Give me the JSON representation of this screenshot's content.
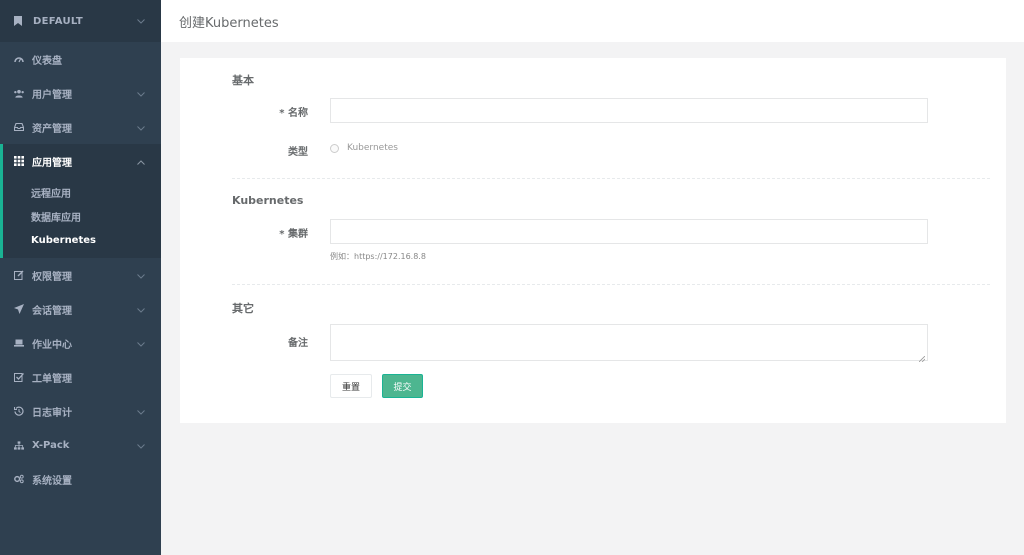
{
  "sidebar": {
    "org": "DEFAULT",
    "items": [
      {
        "label": "仪表盘",
        "icon": "dashboard-icon"
      },
      {
        "label": "用户管理",
        "icon": "users-icon"
      },
      {
        "label": "资产管理",
        "icon": "inbox-icon"
      },
      {
        "label": "应用管理",
        "icon": "apps-grid-icon"
      },
      {
        "label": "权限管理",
        "icon": "edit-icon"
      },
      {
        "label": "会话管理",
        "icon": "rocket-icon"
      },
      {
        "label": "作业中心",
        "icon": "laptop-icon"
      },
      {
        "label": "工单管理",
        "icon": "check-square-icon"
      },
      {
        "label": "日志审计",
        "icon": "history-icon"
      },
      {
        "label": "X-Pack",
        "icon": "sitemap-icon"
      },
      {
        "label": "系统设置",
        "icon": "gears-icon"
      }
    ],
    "sub_items": [
      {
        "label": "远程应用"
      },
      {
        "label": "数据库应用"
      },
      {
        "label": "Kubernetes"
      }
    ]
  },
  "header": {
    "title": "创建Kubernetes"
  },
  "form": {
    "section_basic": "基本",
    "name_label": "* 名称",
    "name_value": "",
    "type_label": "类型",
    "type_value": "Kubernetes",
    "section_k8s": "Kubernetes",
    "cluster_label": "* 集群",
    "cluster_value": "",
    "cluster_hint": "例如：https://172.16.8.8",
    "section_other": "其它",
    "comment_label": "备注",
    "reset_label": "重置",
    "submit_label": "提交"
  },
  "colors": {
    "sidebar_bg": "#2f4050",
    "accent": "#1ab394",
    "submit": "#4db690"
  }
}
